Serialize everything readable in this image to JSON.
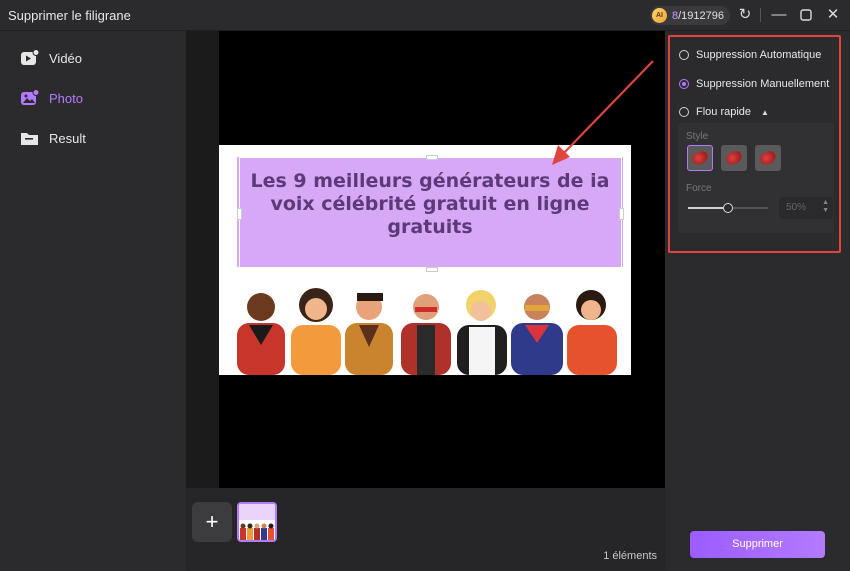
{
  "window": {
    "title": "Supprimer le filigrane",
    "credits_badge": "AI",
    "credits_used": "8",
    "credits_total": "/1912796"
  },
  "sidebar": {
    "items": [
      {
        "label": "Vidéo",
        "icon": "video-icon",
        "active": false
      },
      {
        "label": "Photo",
        "icon": "photo-icon",
        "active": true
      },
      {
        "label": "Result",
        "icon": "folder-icon",
        "active": false
      }
    ]
  },
  "image": {
    "banner_text": "Les 9 meilleurs générateurs de ia voix célébrité gratuit en ligne gratuits"
  },
  "bottom": {
    "add_label": "+",
    "count": "1 éléments"
  },
  "options": {
    "auto": "Suppression Automatique",
    "manual": "Suppression Manuellement",
    "quick_blur": "Flou rapide",
    "style_label": "Style",
    "force_label": "Force",
    "force_value": "50%",
    "force_level": 0.5,
    "selected": "manual"
  },
  "actions": {
    "remove": "Supprimer"
  },
  "colors": {
    "accent": "#b27bff",
    "highlight_border": "#e0443c",
    "banner": "#d6a8f5"
  }
}
